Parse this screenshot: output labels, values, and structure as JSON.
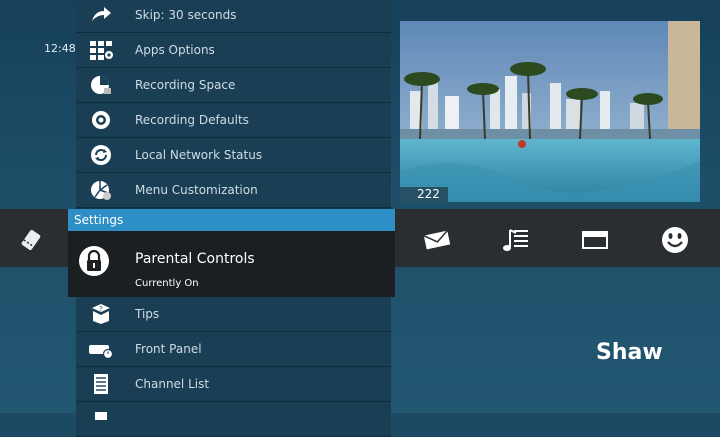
{
  "clock": "12:48",
  "channel_number": "222",
  "brand_logo": "Shaw",
  "settings_header": "Settings",
  "selected_item": {
    "title": "Parental Controls",
    "subtitle": "Currently On",
    "icon": "lock-icon"
  },
  "menu_items_top": [
    {
      "label": "Skip: 30 seconds",
      "icon": "skip-arrow-icon"
    },
    {
      "label": "Apps Options",
      "icon": "apps-grid-icon"
    },
    {
      "label": "Recording Space",
      "icon": "recording-space-icon"
    },
    {
      "label": "Recording Defaults",
      "icon": "gear-icon"
    },
    {
      "label": "Local Network Status",
      "icon": "refresh-icon"
    },
    {
      "label": "Menu Customization",
      "icon": "menu-customization-icon"
    }
  ],
  "menu_items_bottom": [
    {
      "label": "Tips",
      "icon": "tips-icon"
    },
    {
      "label": "Front Panel",
      "icon": "front-panel-icon"
    },
    {
      "label": "Channel List",
      "icon": "channel-list-icon"
    }
  ],
  "menu_bar_icons": [
    "ticket-icon",
    "envelope-icon",
    "music-list-icon",
    "window-icon",
    "smiley-icon"
  ],
  "colors": {
    "accent": "#2e8fc7",
    "background": "#1d4a63",
    "bar": "#2a2e31",
    "selected_bg": "#1b1f22"
  }
}
